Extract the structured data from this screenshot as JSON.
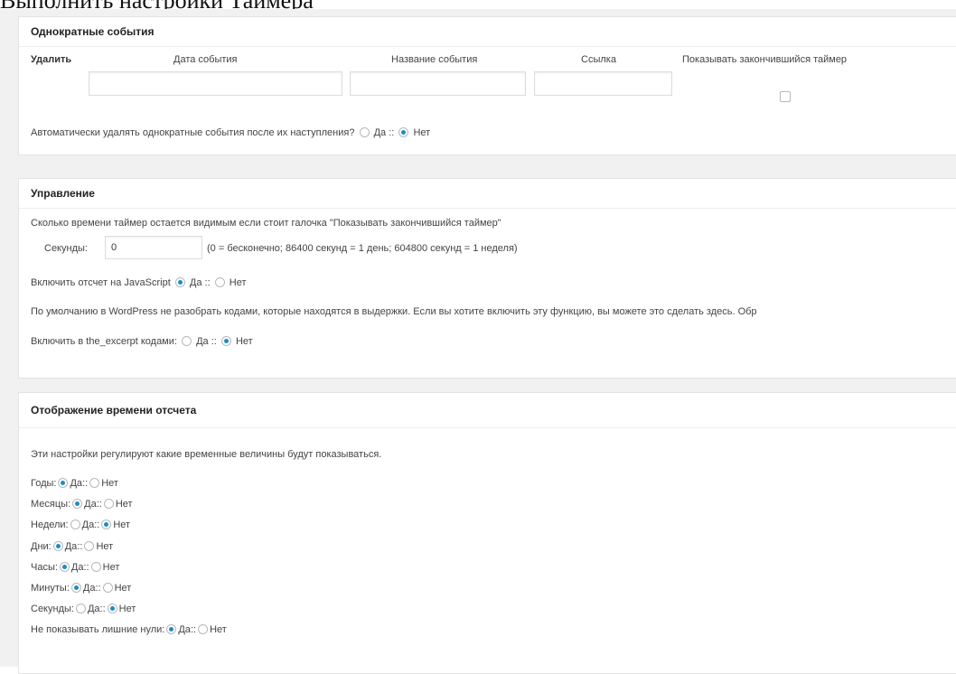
{
  "page_title": "Выполнить настройки Таймера",
  "one_time": {
    "title": "Однократные события",
    "columns": {
      "delete": "Удалить",
      "date": "Дата события",
      "name": "Название события",
      "link": "Ссылка",
      "show_expired": "Показывать закончившийся таймер"
    },
    "auto_delete_label": "Автоматически удалять однократные события после их наступления?",
    "yes": "Да",
    "sep": "::",
    "no": "Нет",
    "auto_delete_value": "no"
  },
  "control": {
    "title": "Управление",
    "visible_desc": "Сколько времени таймер остается видимым если стоит галочка \"Показывать закончившийся таймер\"",
    "seconds_label": "Секунды:",
    "seconds_value": "0",
    "seconds_hint": "(0 = бесконечно; 86400 секунд = 1 день; 604800 секунд = 1 неделя)",
    "js_label": "Включить отсчет на JavaScript",
    "js_value": "yes",
    "excerpt_desc": "По умолчанию в WordPress не разобрать кодами, которые находятся в выдержки. Если вы хотите включить эту функцию, вы можете это сделать здесь. Обр",
    "excerpt_label": "Включить в the_excerpt кодами:",
    "excerpt_value": "no",
    "yes": "Да",
    "sep": "::",
    "no": "Нет"
  },
  "display": {
    "title": "Отображение времени отсчета",
    "desc": "Эти настройки регулируют какие временные величины будут показываться.",
    "yes": "Да",
    "sep": "::",
    "no": "Нет",
    "items": [
      {
        "label": "Годы:",
        "value": "yes"
      },
      {
        "label": "Месяцы:",
        "value": "yes"
      },
      {
        "label": "Недели:",
        "value": "no"
      },
      {
        "label": "Дни:",
        "value": "yes"
      },
      {
        "label": "Часы:",
        "value": "yes"
      },
      {
        "label": "Минуты:",
        "value": "yes"
      },
      {
        "label": "Секунды:",
        "value": "no"
      },
      {
        "label": "Не показывать лишние нули:",
        "value": "yes"
      }
    ]
  },
  "colors": {
    "radio_selected": "#1e8cbe",
    "background": "#f1f1f1",
    "panel": "#ffffff"
  }
}
